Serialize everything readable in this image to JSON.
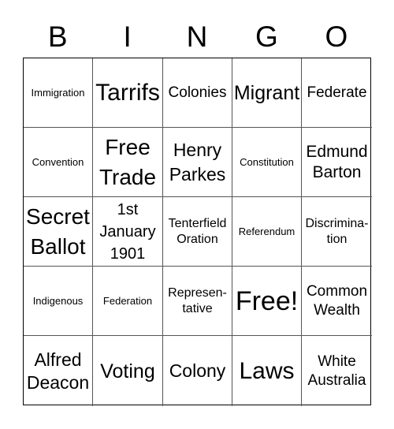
{
  "header": {
    "letters": [
      "B",
      "I",
      "N",
      "G",
      "O"
    ]
  },
  "card": {
    "rows": [
      [
        {
          "text": "Immigration",
          "size": "xs"
        },
        {
          "text": "Tarrifs",
          "size": "xl"
        },
        {
          "text": "Colonies",
          "size": "s"
        },
        {
          "text": "Migrant",
          "size": "l"
        },
        {
          "text": "Federate",
          "size": "s"
        }
      ],
      [
        {
          "text": "Convention",
          "size": "xs"
        },
        {
          "text": "Free\nTrade",
          "size": "l2"
        },
        {
          "text": "Henry\nParkes",
          "size": "m"
        },
        {
          "text": "Constitution",
          "size": "xs"
        },
        {
          "text": "Edmund\nBarton",
          "size": "s2"
        }
      ],
      [
        {
          "text": "Secret\nBallot",
          "size": "l2"
        },
        {
          "text": "1st\nJanuary\n1901",
          "size": "s3"
        },
        {
          "text": "Tenterfield\nOration",
          "size": "xs2"
        },
        {
          "text": "Referendum",
          "size": "xs"
        },
        {
          "text": "Discrimina-\ntion",
          "size": "xs2"
        }
      ],
      [
        {
          "text": "Indigenous",
          "size": "xs"
        },
        {
          "text": "Federation",
          "size": "xs"
        },
        {
          "text": "Represen-\ntative",
          "size": "xs2"
        },
        {
          "text": "Free!",
          "size": "free"
        },
        {
          "text": "Common\nWealth",
          "size": "xs2b"
        }
      ],
      [
        {
          "text": "Alfred\nDeacon",
          "size": "s2b"
        },
        {
          "text": "Voting",
          "size": "l"
        },
        {
          "text": "Colony",
          "size": "m"
        },
        {
          "text": "Laws",
          "size": "xl"
        },
        {
          "text": "White\nAustralia",
          "size": "xs2b"
        }
      ]
    ]
  }
}
